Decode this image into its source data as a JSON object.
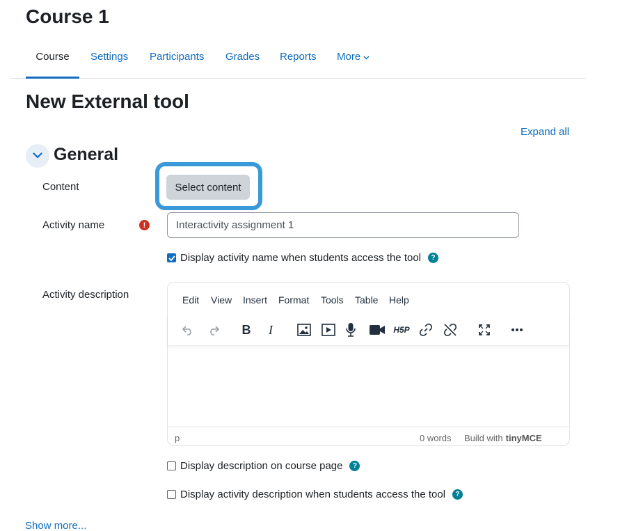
{
  "course": {
    "title": "Course 1"
  },
  "nav": {
    "items": [
      {
        "label": "Course",
        "active": true
      },
      {
        "label": "Settings"
      },
      {
        "label": "Participants"
      },
      {
        "label": "Grades"
      },
      {
        "label": "Reports"
      },
      {
        "label": "More"
      }
    ]
  },
  "page": {
    "title": "New External tool"
  },
  "form": {
    "expand_all": "Expand all",
    "section_title": "General",
    "content_label": "Content",
    "select_content_label": "Select content",
    "activity_name_label": "Activity name",
    "activity_name_value": "Interactivity assignment 1",
    "display_name_checkbox": {
      "label": "Display activity name when students access the tool",
      "checked": true
    },
    "activity_description_label": "Activity description",
    "display_description_checkbox": {
      "label": "Display description on course page",
      "checked": false
    },
    "display_activity_description_checkbox": {
      "label": "Display activity description when students access the tool",
      "checked": false
    },
    "show_more": "Show more..."
  },
  "editor": {
    "menu": [
      "Edit",
      "View",
      "Insert",
      "Format",
      "Tools",
      "Table",
      "Help"
    ],
    "toolbar_icons": [
      "undo-icon",
      "redo-icon",
      "bold-icon",
      "italic-icon",
      "image-icon",
      "media-icon",
      "microphone-icon",
      "video-camera-icon",
      "h5p-icon",
      "link-icon",
      "unlink-icon",
      "fullscreen-icon",
      "more-icon"
    ],
    "status_path": "p",
    "word_count": "0 words",
    "build_with": "Build with",
    "brand": "tinyMCE"
  },
  "colors": {
    "link": "#0f6cbf",
    "highlight_border": "#3a9ad9",
    "required": "#ca3120",
    "help": "#008196"
  }
}
